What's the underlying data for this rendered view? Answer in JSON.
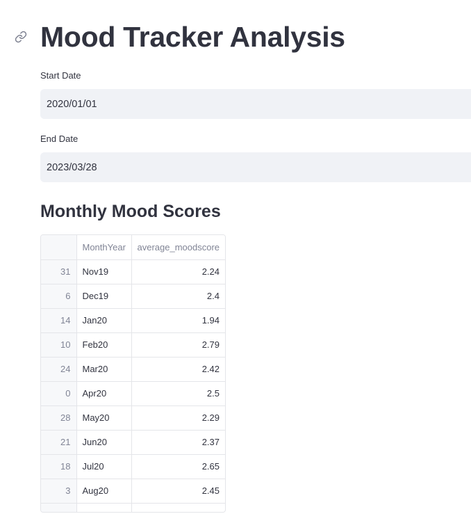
{
  "page": {
    "title": "Mood Tracker Analysis",
    "link_icon": "link-icon"
  },
  "start_date": {
    "label": "Start Date",
    "value": "2020/01/01"
  },
  "end_date": {
    "label": "End Date",
    "value": "2023/03/28"
  },
  "section": {
    "heading": "Monthly Mood Scores"
  },
  "table": {
    "columns": [
      "",
      "MonthYear",
      "average_moodscore"
    ],
    "rows": [
      {
        "index": "31",
        "month": "Nov19",
        "score": "2.24"
      },
      {
        "index": "6",
        "month": "Dec19",
        "score": "2.4"
      },
      {
        "index": "14",
        "month": "Jan20",
        "score": "1.94"
      },
      {
        "index": "10",
        "month": "Feb20",
        "score": "2.79"
      },
      {
        "index": "24",
        "month": "Mar20",
        "score": "2.42"
      },
      {
        "index": "0",
        "month": "Apr20",
        "score": "2.5"
      },
      {
        "index": "28",
        "month": "May20",
        "score": "2.29"
      },
      {
        "index": "21",
        "month": "Jun20",
        "score": "2.37"
      },
      {
        "index": "18",
        "month": "Jul20",
        "score": "2.65"
      },
      {
        "index": "3",
        "month": "Aug20",
        "score": "2.45"
      }
    ]
  }
}
